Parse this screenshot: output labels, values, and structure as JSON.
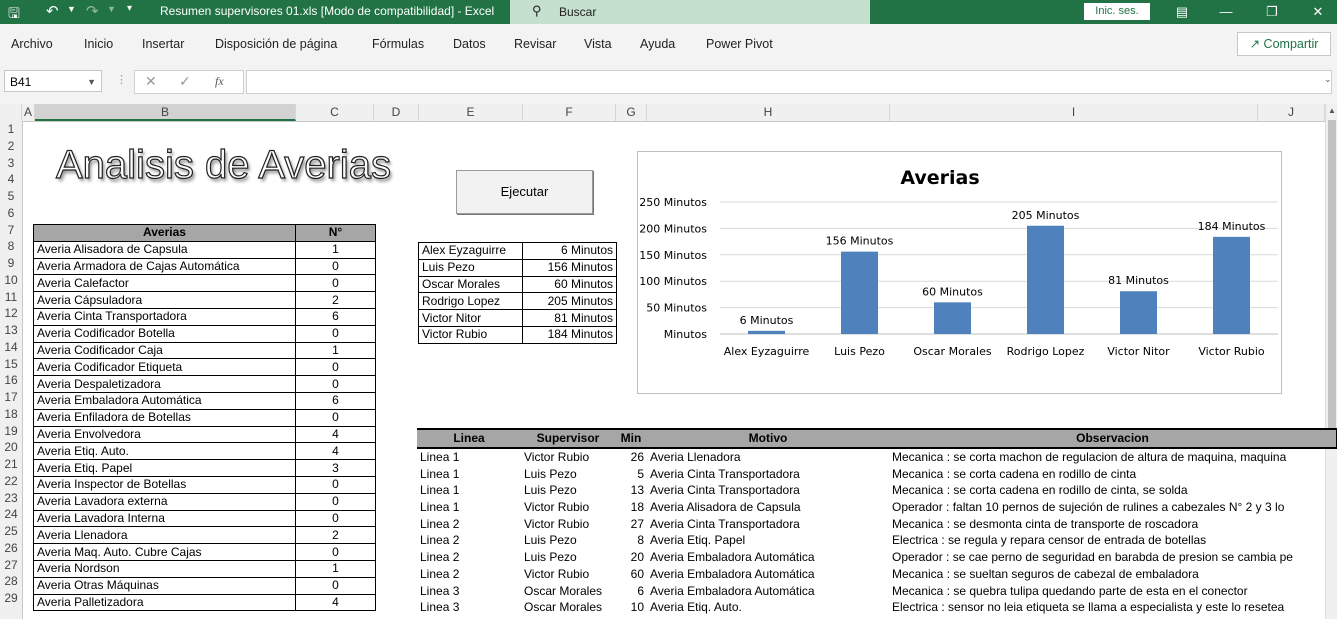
{
  "titlebar": {
    "title": "Resumen supervisores 01.xls  [Modo de compatibilidad]  -  Excel",
    "search": "Buscar",
    "signin": "Inic. ses."
  },
  "ribbon": {
    "tabs": [
      "Archivo",
      "Inicio",
      "Insertar",
      "Disposición de página",
      "Fórmulas",
      "Datos",
      "Revisar",
      "Vista",
      "Ayuda",
      "Power Pivot"
    ],
    "share": "Compartir"
  },
  "formula_bar": {
    "name_box": "B41",
    "fx": "fx",
    "formula": ""
  },
  "columns": [
    "A",
    "B",
    "C",
    "D",
    "E",
    "F",
    "G",
    "H",
    "I",
    "J"
  ],
  "rows": [
    "1",
    "2",
    "3",
    "4",
    "5",
    "6",
    "7",
    "8",
    "9",
    "10",
    "11",
    "12",
    "13",
    "14",
    "15",
    "16",
    "17",
    "18",
    "19",
    "20",
    "21",
    "22",
    "23",
    "24",
    "25",
    "26",
    "27",
    "28",
    "29"
  ],
  "sheet_title": "Analisis de Averias",
  "run_button": "Ejecutar",
  "averias_table": {
    "headers": [
      "Averias",
      "N°"
    ],
    "rows": [
      [
        "Averia Alisadora de Capsula",
        "1"
      ],
      [
        "Averia Armadora de Cajas Automática",
        "0"
      ],
      [
        "Averia Calefactor",
        "0"
      ],
      [
        "Averia Cápsuladora",
        "2"
      ],
      [
        "Averia Cinta Transportadora",
        "6"
      ],
      [
        "Averia Codificador Botella",
        "0"
      ],
      [
        "Averia Codificador Caja",
        "1"
      ],
      [
        "Averia Codificador Etiqueta",
        "0"
      ],
      [
        "Averia Despaletizadora",
        "0"
      ],
      [
        "Averia Embaladora Automática",
        "6"
      ],
      [
        "Averia Enfiladora de Botellas",
        "0"
      ],
      [
        "Averia Envolvedora",
        "4"
      ],
      [
        "Averia Etiq. Auto.",
        "4"
      ],
      [
        "Averia Etiq. Papel",
        "3"
      ],
      [
        "Averia Inspector de Botellas",
        "0"
      ],
      [
        "Averia Lavadora externa",
        "0"
      ],
      [
        "Averia Lavadora Interna",
        "0"
      ],
      [
        "Averia Llenadora",
        "2"
      ],
      [
        "Averia Maq. Auto. Cubre Cajas",
        "0"
      ],
      [
        "Averia Nordson",
        "1"
      ],
      [
        "Averia Otras Máquinas",
        "0"
      ],
      [
        "Averia Palletizadora",
        "4"
      ]
    ]
  },
  "supervisor_table": [
    [
      "Alex Eyzaguirre",
      "6 Minutos"
    ],
    [
      "Luis Pezo",
      "156 Minutos"
    ],
    [
      "Oscar Morales",
      "60 Minutos"
    ],
    [
      "Rodrigo Lopez",
      "205 Minutos"
    ],
    [
      "Victor Nitor",
      "81 Minutos"
    ],
    [
      "Victor Rubio",
      "184 Minutos"
    ]
  ],
  "chart_data": {
    "type": "bar",
    "title": "Averias",
    "categories": [
      "Alex Eyzaguirre",
      "Luis Pezo",
      "Oscar Morales",
      "Rodrigo Lopez",
      "Victor Nitor",
      "Victor Rubio"
    ],
    "values": [
      6,
      156,
      60,
      205,
      81,
      184
    ],
    "data_labels": [
      "6 Minutos",
      "156 Minutos",
      "60 Minutos",
      "205 Minutos",
      "81 Minutos",
      "184 Minutos"
    ],
    "ytick_labels": [
      "Minutos",
      "50 Minutos",
      "100 Minutos",
      "150 Minutos",
      "200 Minutos",
      "250 Minutos"
    ],
    "yticks": [
      0,
      50,
      100,
      150,
      200,
      250
    ],
    "ylim": [
      0,
      250
    ],
    "grid": true,
    "bar_color": "#4f81bd"
  },
  "detail_table": {
    "headers": [
      "Linea",
      "Supervisor",
      "Min",
      "Motivo",
      "Observacion"
    ],
    "rows": [
      [
        "Linea 1",
        "Victor Rubio",
        "26",
        "Averia Llenadora",
        "Mecanica : se corta machon de regulacion de altura de maquina, maquina"
      ],
      [
        "Linea 1",
        "Luis Pezo",
        "5",
        "Averia Cinta Transportadora",
        "Mecanica : se corta cadena en rodillo de cinta"
      ],
      [
        "Linea 1",
        "Luis Pezo",
        "13",
        "Averia Cinta Transportadora",
        "Mecanica : se corta cadena en rodillo de cinta, se solda"
      ],
      [
        "Linea 1",
        "Victor Rubio",
        "18",
        "Averia Alisadora de Capsula",
        "Operador :  faltan 10 pernos de sujeción de rulines a cabezales N° 2 y 3 lo"
      ],
      [
        "Linea 2",
        "Victor Rubio",
        "27",
        "Averia Cinta Transportadora",
        "Mecanica : se desmonta cinta de transporte de roscadora"
      ],
      [
        "Linea 2",
        "Luis Pezo",
        "8",
        "Averia Etiq. Papel",
        "Electrica : se regula y repara censor de entrada de botellas"
      ],
      [
        "Linea 2",
        "Luis Pezo",
        "20",
        "Averia Embaladora Automática",
        "Operador :  se cae perno de seguridad en barabda de presion se cambia pe"
      ],
      [
        "Linea 2",
        "Victor Rubio",
        "60",
        "Averia Embaladora Automática",
        "Mecanica : se sueltan seguros de cabezal de embaladora"
      ],
      [
        "Linea 3",
        "Oscar Morales",
        "6",
        "Averia Embaladora Automática",
        "Mecanica : se quebra tulipa quedando parte de esta en el conector"
      ],
      [
        "Linea 3",
        "Oscar Morales",
        "10",
        "Averia Etiq. Auto.",
        "Electrica : sensor no leia etiqueta se llama a especialista y este lo reseteа"
      ]
    ]
  }
}
